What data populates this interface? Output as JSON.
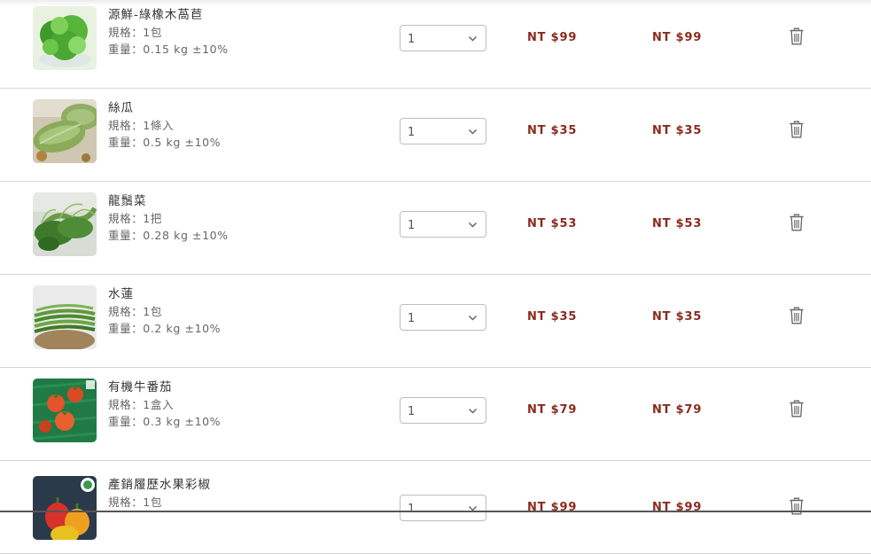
{
  "cart": {
    "items": [
      {
        "name": "源鮮-綠橡木萵苣",
        "spec": "規格：1包",
        "weight": "重量：0.15 kg ±10%",
        "quantity": "1",
        "unit_price": "NT $99",
        "subtotal": "NT $99",
        "image": "green-oak-lettuce"
      },
      {
        "name": "絲瓜",
        "spec": "規格：1條入",
        "weight": "重量：0.5 kg ±10%",
        "quantity": "1",
        "unit_price": "NT $35",
        "subtotal": "NT $35",
        "image": "loofah"
      },
      {
        "name": "龍鬚菜",
        "spec": "規格：1把",
        "weight": "重量：0.28 kg ±10%",
        "quantity": "1",
        "unit_price": "NT $53",
        "subtotal": "NT $53",
        "image": "chayote-shoots"
      },
      {
        "name": "水蓮",
        "spec": "規格：1包",
        "weight": "重量：0.2 kg ±10%",
        "quantity": "1",
        "unit_price": "NT $35",
        "subtotal": "NT $35",
        "image": "water-lotus-stems"
      },
      {
        "name": "有機牛番茄",
        "spec": "規格：1盒入",
        "weight": "重量：0.3 kg ±10%",
        "quantity": "1",
        "unit_price": "NT $79",
        "subtotal": "NT $79",
        "image": "organic-tomatoes"
      },
      {
        "name": "產銷履歷水果彩椒",
        "spec": "規格：1包",
        "weight": "",
        "quantity": "1",
        "unit_price": "NT $99",
        "subtotal": "NT $99",
        "image": "bell-peppers"
      }
    ],
    "icons": {
      "quantity_dropdown": "chevron-down-icon",
      "remove": "trash-icon"
    },
    "colors": {
      "price": "#8a2b1e",
      "divider": "#d6d6d6"
    }
  }
}
